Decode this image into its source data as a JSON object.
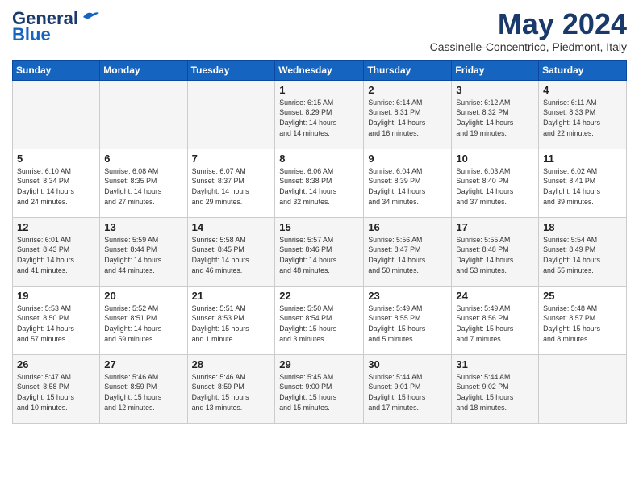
{
  "logo": {
    "line1": "General",
    "line2": "Blue"
  },
  "title": "May 2024",
  "subtitle": "Cassinelle-Concentrico, Piedmont, Italy",
  "days_of_week": [
    "Sunday",
    "Monday",
    "Tuesday",
    "Wednesday",
    "Thursday",
    "Friday",
    "Saturday"
  ],
  "weeks": [
    [
      {
        "day": "",
        "info": ""
      },
      {
        "day": "",
        "info": ""
      },
      {
        "day": "",
        "info": ""
      },
      {
        "day": "1",
        "info": "Sunrise: 6:15 AM\nSunset: 8:29 PM\nDaylight: 14 hours\nand 14 minutes."
      },
      {
        "day": "2",
        "info": "Sunrise: 6:14 AM\nSunset: 8:31 PM\nDaylight: 14 hours\nand 16 minutes."
      },
      {
        "day": "3",
        "info": "Sunrise: 6:12 AM\nSunset: 8:32 PM\nDaylight: 14 hours\nand 19 minutes."
      },
      {
        "day": "4",
        "info": "Sunrise: 6:11 AM\nSunset: 8:33 PM\nDaylight: 14 hours\nand 22 minutes."
      }
    ],
    [
      {
        "day": "5",
        "info": "Sunrise: 6:10 AM\nSunset: 8:34 PM\nDaylight: 14 hours\nand 24 minutes."
      },
      {
        "day": "6",
        "info": "Sunrise: 6:08 AM\nSunset: 8:35 PM\nDaylight: 14 hours\nand 27 minutes."
      },
      {
        "day": "7",
        "info": "Sunrise: 6:07 AM\nSunset: 8:37 PM\nDaylight: 14 hours\nand 29 minutes."
      },
      {
        "day": "8",
        "info": "Sunrise: 6:06 AM\nSunset: 8:38 PM\nDaylight: 14 hours\nand 32 minutes."
      },
      {
        "day": "9",
        "info": "Sunrise: 6:04 AM\nSunset: 8:39 PM\nDaylight: 14 hours\nand 34 minutes."
      },
      {
        "day": "10",
        "info": "Sunrise: 6:03 AM\nSunset: 8:40 PM\nDaylight: 14 hours\nand 37 minutes."
      },
      {
        "day": "11",
        "info": "Sunrise: 6:02 AM\nSunset: 8:41 PM\nDaylight: 14 hours\nand 39 minutes."
      }
    ],
    [
      {
        "day": "12",
        "info": "Sunrise: 6:01 AM\nSunset: 8:43 PM\nDaylight: 14 hours\nand 41 minutes."
      },
      {
        "day": "13",
        "info": "Sunrise: 5:59 AM\nSunset: 8:44 PM\nDaylight: 14 hours\nand 44 minutes."
      },
      {
        "day": "14",
        "info": "Sunrise: 5:58 AM\nSunset: 8:45 PM\nDaylight: 14 hours\nand 46 minutes."
      },
      {
        "day": "15",
        "info": "Sunrise: 5:57 AM\nSunset: 8:46 PM\nDaylight: 14 hours\nand 48 minutes."
      },
      {
        "day": "16",
        "info": "Sunrise: 5:56 AM\nSunset: 8:47 PM\nDaylight: 14 hours\nand 50 minutes."
      },
      {
        "day": "17",
        "info": "Sunrise: 5:55 AM\nSunset: 8:48 PM\nDaylight: 14 hours\nand 53 minutes."
      },
      {
        "day": "18",
        "info": "Sunrise: 5:54 AM\nSunset: 8:49 PM\nDaylight: 14 hours\nand 55 minutes."
      }
    ],
    [
      {
        "day": "19",
        "info": "Sunrise: 5:53 AM\nSunset: 8:50 PM\nDaylight: 14 hours\nand 57 minutes."
      },
      {
        "day": "20",
        "info": "Sunrise: 5:52 AM\nSunset: 8:51 PM\nDaylight: 14 hours\nand 59 minutes."
      },
      {
        "day": "21",
        "info": "Sunrise: 5:51 AM\nSunset: 8:53 PM\nDaylight: 15 hours\nand 1 minute."
      },
      {
        "day": "22",
        "info": "Sunrise: 5:50 AM\nSunset: 8:54 PM\nDaylight: 15 hours\nand 3 minutes."
      },
      {
        "day": "23",
        "info": "Sunrise: 5:49 AM\nSunset: 8:55 PM\nDaylight: 15 hours\nand 5 minutes."
      },
      {
        "day": "24",
        "info": "Sunrise: 5:49 AM\nSunset: 8:56 PM\nDaylight: 15 hours\nand 7 minutes."
      },
      {
        "day": "25",
        "info": "Sunrise: 5:48 AM\nSunset: 8:57 PM\nDaylight: 15 hours\nand 8 minutes."
      }
    ],
    [
      {
        "day": "26",
        "info": "Sunrise: 5:47 AM\nSunset: 8:58 PM\nDaylight: 15 hours\nand 10 minutes."
      },
      {
        "day": "27",
        "info": "Sunrise: 5:46 AM\nSunset: 8:59 PM\nDaylight: 15 hours\nand 12 minutes."
      },
      {
        "day": "28",
        "info": "Sunrise: 5:46 AM\nSunset: 8:59 PM\nDaylight: 15 hours\nand 13 minutes."
      },
      {
        "day": "29",
        "info": "Sunrise: 5:45 AM\nSunset: 9:00 PM\nDaylight: 15 hours\nand 15 minutes."
      },
      {
        "day": "30",
        "info": "Sunrise: 5:44 AM\nSunset: 9:01 PM\nDaylight: 15 hours\nand 17 minutes."
      },
      {
        "day": "31",
        "info": "Sunrise: 5:44 AM\nSunset: 9:02 PM\nDaylight: 15 hours\nand 18 minutes."
      },
      {
        "day": "",
        "info": ""
      }
    ]
  ]
}
